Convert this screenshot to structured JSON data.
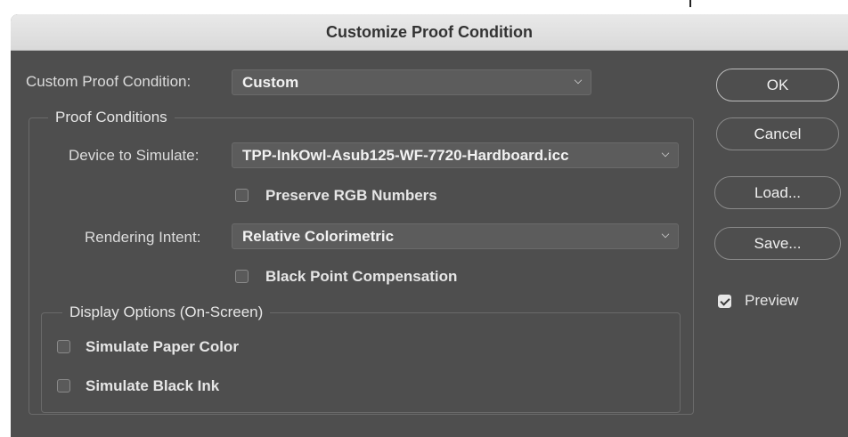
{
  "dialog": {
    "title": "Customize Proof Condition"
  },
  "custom_condition": {
    "label": "Custom Proof Condition:",
    "value": "Custom"
  },
  "proof_conditions": {
    "legend": "Proof Conditions",
    "device_label": "Device to Simulate:",
    "device_value": "TPP-InkOwl-Asub125-WF-7720-Hardboard.icc",
    "preserve_rgb_label": "Preserve RGB Numbers",
    "preserve_rgb_checked": false,
    "intent_label": "Rendering Intent:",
    "intent_value": "Relative Colorimetric",
    "bpc_label": "Black Point Compensation",
    "bpc_checked": false
  },
  "display_options": {
    "legend": "Display Options (On-Screen)",
    "paper_color_label": "Simulate Paper Color",
    "paper_color_checked": false,
    "black_ink_label": "Simulate Black Ink",
    "black_ink_checked": false
  },
  "buttons": {
    "ok": "OK",
    "cancel": "Cancel",
    "load": "Load...",
    "save": "Save..."
  },
  "preview": {
    "label": "Preview",
    "checked": true
  },
  "colors": {
    "window_bg": "#4e4e4e",
    "titlebar_bg": "#dedede",
    "field_bg": "#5c5c5c",
    "text": "#e6e6e6"
  }
}
